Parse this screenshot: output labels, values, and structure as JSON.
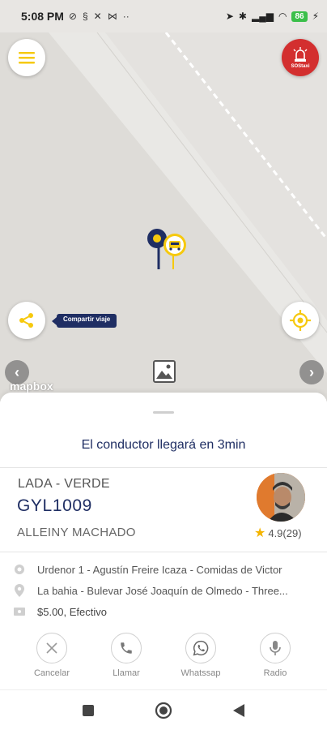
{
  "status_bar": {
    "time": "5:08 PM",
    "battery": "86"
  },
  "map": {
    "share_tag": "Compartir viaje",
    "sos_label": "SOStaxi",
    "attribution": "mapbox"
  },
  "trip": {
    "eta_text": "El conductor llegará en 3min",
    "vehicle": "LADA - VERDE",
    "plate": "GYL1009",
    "driver_name": "ALLEINY MACHADO",
    "rating": "4.9(29)"
  },
  "details": {
    "origin": "Urdenor 1 - Agustín Freire Icaza - Comidas de Victor",
    "destination": "La bahia - Bulevar José Joaquín de Olmedo - Three...",
    "payment": "$5.00, Efectivo"
  },
  "actions": {
    "cancel": "Cancelar",
    "call": "Llamar",
    "whatsapp": "Whatssap",
    "radio": "Radio"
  },
  "colors": {
    "brand_navy": "#1f2e63",
    "accent_yellow": "#f6c90e",
    "sos_red": "#d32f2f"
  }
}
